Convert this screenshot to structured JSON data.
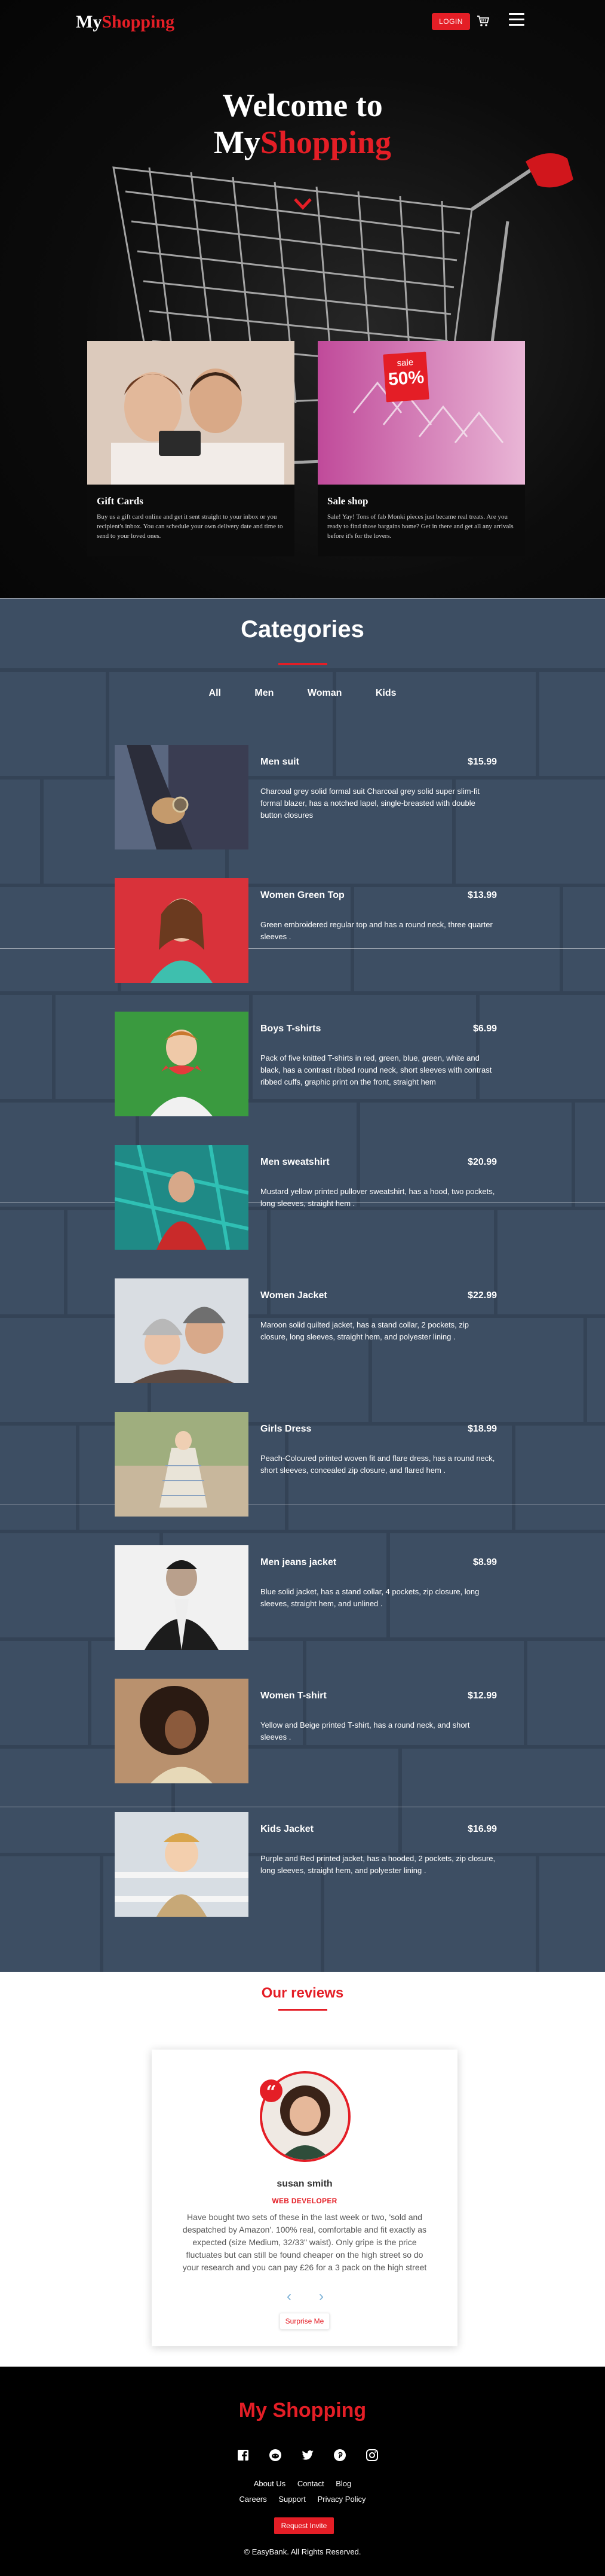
{
  "nav": {
    "brand_part1": "My",
    "brand_part2": "Shopping",
    "login_label": "LOGIN",
    "cart_icon": "cart-icon",
    "menu_icon": "hamburger-menu-icon"
  },
  "hero": {
    "title_line1": "Welcome to",
    "title_line2_part1": "My",
    "title_line2_part2": "Shopping",
    "scroll_icon": "chevron-down-icon"
  },
  "promos": [
    {
      "title": "Gift Cards",
      "text": "Buy us a gift card online and get it sent straight to your inbox or you recipient's inbox. You can schedule your own delivery date and time to send to your loved ones."
    },
    {
      "title": "Sale shop",
      "text": "Sale! Yay! Tons of fab Monki pieces just became real treats. Are you ready to find those bargains home? Get in there and get all any arrivals before it's for the lovers.",
      "tag_word": "sale",
      "tag_number": "50%"
    }
  ],
  "categories": {
    "title": "Categories",
    "filters": [
      "All",
      "Men",
      "Woman",
      "Kids"
    ],
    "products": [
      {
        "name": "Men suit",
        "price": "$15.99",
        "description": "Charcoal grey solid formal suit Charcoal grey solid super slim-fit formal blazer, has a notched lapel, single-breasted with double button closures"
      },
      {
        "name": "Women Green Top",
        "price": "$13.99",
        "description": "Green embroidered regular top and has a round neck, three quarter sleeves ."
      },
      {
        "name": "Boys T-shirts",
        "price": "$6.99",
        "description": "Pack of five knitted T-shirts in red, green, blue, green, white and black, has a contrast ribbed round neck, short sleeves with contrast ribbed cuffs, graphic print on the front, straight hem"
      },
      {
        "name": "Men sweatshirt",
        "price": "$20.99",
        "description": "Mustard yellow printed pullover sweatshirt, has a hood, two pockets, long sleeves, straight hem ."
      },
      {
        "name": "Women Jacket",
        "price": "$22.99",
        "description": "Maroon solid quilted jacket, has a stand collar, 2 pockets, zip closure, long sleeves, straight hem, and polyester lining ."
      },
      {
        "name": "Girls Dress",
        "price": "$18.99",
        "description": "Peach-Coloured printed woven fit and flare dress, has a round neck, short sleeves, concealed zip closure, and flared hem ."
      },
      {
        "name": "Men jeans jacket",
        "price": "$8.99",
        "description": "Blue solid jacket, has a stand collar, 4 pockets, zip closure, long sleeves, straight hem, and unlined ."
      },
      {
        "name": "Women T-shirt",
        "price": "$12.99",
        "description": "Yellow and Beige printed T-shirt, has a round neck, and short sleeves ."
      },
      {
        "name": "Kids Jacket",
        "price": "$16.99",
        "description": "Purple and Red printed jacket, has a hooded, 2 pockets, zip closure, long sleeves, straight hem, and polyester lining ."
      }
    ]
  },
  "reviews": {
    "title": "Our reviews",
    "name": "susan smith",
    "role": "WEB DEVELOPER",
    "text": "Have bought two sets of these in the last week or two, 'sold and despatched by Amazon'. 100% real, comfortable and fit exactly as expected (size Medium, 32/33\" waist). Only gripe is the price fluctuates but can still be found cheaper on the high street so do your research and you can pay £26 for a 3 pack on the high street",
    "prev_icon": "chevron-left-icon",
    "next_icon": "chevron-right-icon",
    "surprise_label": "Surprise Me"
  },
  "footer": {
    "brand": "My Shopping",
    "socials": [
      "facebook-icon",
      "reddit-icon",
      "twitter-icon",
      "pinterest-icon",
      "instagram-icon"
    ],
    "links_row1": [
      "About Us",
      "Contact",
      "Blog"
    ],
    "links_row2": [
      "Careers",
      "Support",
      "Privacy Policy"
    ],
    "invite_label": "Request Invite",
    "copyright": "© EasyBank. All Rights Reserved."
  },
  "colors": {
    "accent": "#e41e26",
    "hero_bg": "#0c0c0c",
    "category_bg": "#3d4e63",
    "footer_bg": "#000000"
  }
}
